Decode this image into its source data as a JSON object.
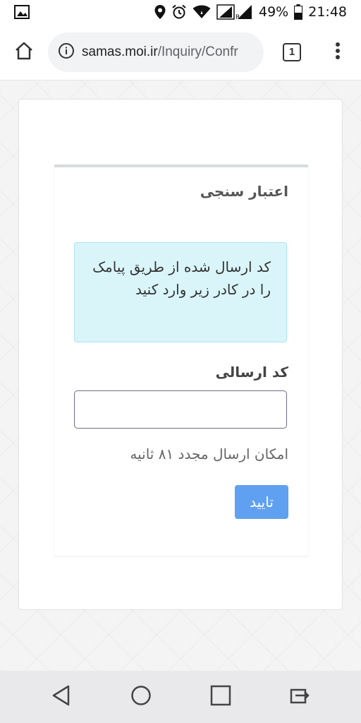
{
  "status_bar": {
    "battery": "49%",
    "time": "21:48",
    "icons": [
      "image-icon",
      "location-icon",
      "alarm-icon",
      "wifi-icon",
      "signal-icon",
      "battery-icon"
    ]
  },
  "browser": {
    "url_host": "samas.moi.ir",
    "url_path": "/Inquiry/Confr",
    "tab_count": "1",
    "icons": [
      "home-icon",
      "info-icon",
      "menu-dots-icon"
    ]
  },
  "auth": {
    "title": "اعتبار سنجی",
    "info_message": "کد ارسال شده از طریق پیامک را در کادر زیر وارد کنید",
    "code_label": "کد ارسالی",
    "code_value": "",
    "resend_text": "امکان ارسال مجدد ۸۱ ثانیه",
    "confirm_label": "تایید"
  },
  "colors": {
    "info_bg": "#d9f5fa",
    "button_bg": "#5fa1f0",
    "page_bg": "#f4f4f4"
  },
  "nav": {
    "icons": [
      "back-icon",
      "home-circle-icon",
      "recents-icon",
      "switch-app-icon"
    ]
  }
}
